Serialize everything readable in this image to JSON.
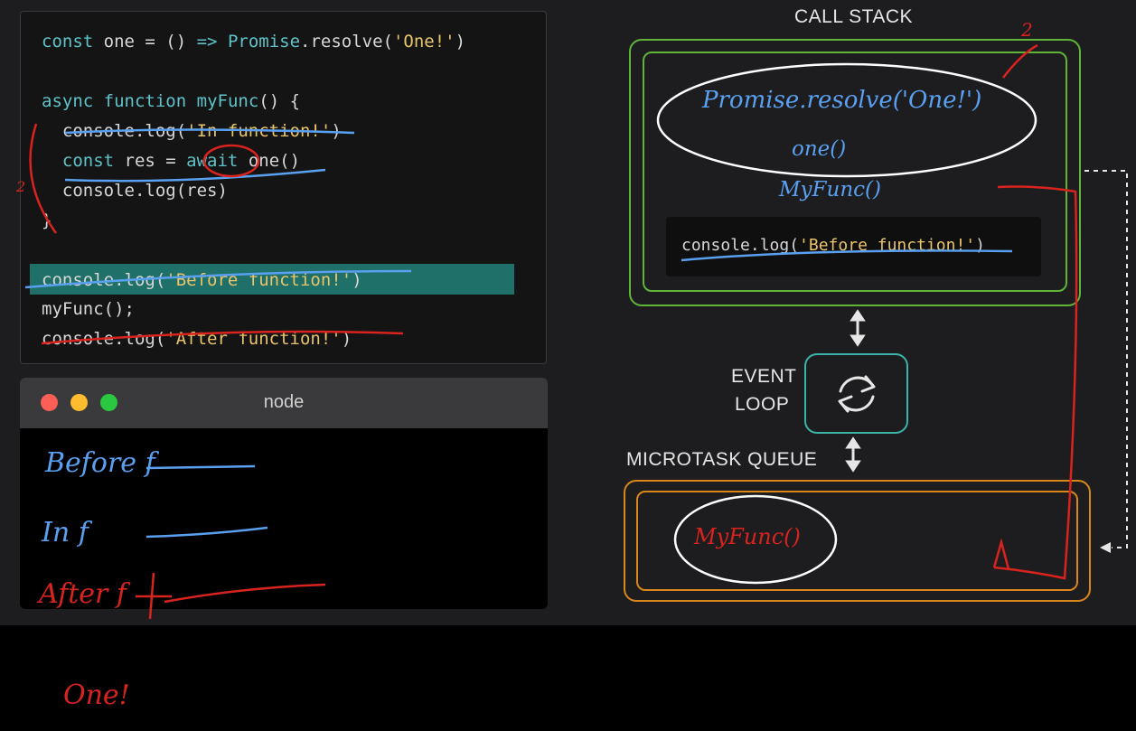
{
  "code": {
    "lines": [
      [
        {
          "t": "const",
          "c": "kw"
        },
        {
          "t": " one = () ",
          "c": "pl"
        },
        {
          "t": "=>",
          "c": "kw"
        },
        {
          "t": " ",
          "c": "pl"
        },
        {
          "t": "Promise",
          "c": "fn"
        },
        {
          "t": ".resolve(",
          "c": "pl"
        },
        {
          "t": "'One!'",
          "c": "str"
        },
        {
          "t": ")",
          "c": "pl"
        }
      ],
      [],
      [
        {
          "t": "async",
          "c": "kw"
        },
        {
          "t": " ",
          "c": "pl"
        },
        {
          "t": "function",
          "c": "kw"
        },
        {
          "t": " ",
          "c": "pl"
        },
        {
          "t": "myFunc",
          "c": "fn"
        },
        {
          "t": "() {",
          "c": "pl"
        }
      ],
      [
        {
          "t": "  console.log(",
          "c": "pl"
        },
        {
          "t": "'In function!'",
          "c": "str"
        },
        {
          "t": ")",
          "c": "pl"
        }
      ],
      [
        {
          "t": "  ",
          "c": "pl"
        },
        {
          "t": "const",
          "c": "kw"
        },
        {
          "t": " res = ",
          "c": "pl"
        },
        {
          "t": "await",
          "c": "kw"
        },
        {
          "t": " one()",
          "c": "pl"
        }
      ],
      [
        {
          "t": "  console.log(res)",
          "c": "pl"
        }
      ],
      [
        {
          "t": "}",
          "c": "pl"
        }
      ],
      [],
      [
        {
          "t": "console.log(",
          "c": "pl"
        },
        {
          "t": "'Before function!'",
          "c": "str"
        },
        {
          "t": ")",
          "c": "pl"
        }
      ],
      [
        {
          "t": "myFunc();",
          "c": "pl"
        }
      ],
      [
        {
          "t": "console.log(",
          "c": "pl"
        },
        {
          "t": "'After function!'",
          "c": "str"
        },
        {
          "t": ")",
          "c": "pl"
        }
      ]
    ]
  },
  "terminal": {
    "title": "node"
  },
  "diagram": {
    "call_stack_label": "CALL STACK",
    "event_loop_label_1": "EVENT",
    "event_loop_label_2": "LOOP",
    "microtask_label": "MICROTASK QUEUE",
    "console_entry": [
      {
        "t": "console.log(",
        "c": "pl"
      },
      {
        "t": "'Before function!'",
        "c": "str"
      },
      {
        "t": ")",
        "c": "pl"
      }
    ]
  },
  "annotations": {
    "stack_promise": "Promise.resolve('One!')",
    "stack_one": "one()",
    "stack_myfunc": "MyFunc()",
    "queue_myfunc": "MyFunc()",
    "out_before": "Before f",
    "out_in": "In f",
    "out_after": "After f",
    "out_one": "One!"
  },
  "colors": {
    "blue_ink": "#5aa0f0",
    "red_ink": "#d8231e",
    "stack_green": "#5fb43a",
    "queue_orange": "#d9871b",
    "loop_teal": "#3ab5a8"
  }
}
